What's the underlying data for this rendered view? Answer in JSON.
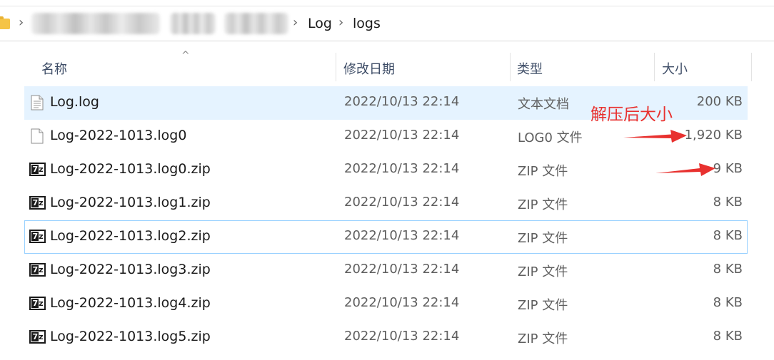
{
  "address_bar": {
    "separator": "›",
    "crumbs": [
      "Log",
      "logs"
    ]
  },
  "columns": {
    "name": "名称",
    "date": "修改日期",
    "type": "类型",
    "size": "大小",
    "sort_glyph": "^"
  },
  "files": [
    {
      "name": "Log.log",
      "date": "2022/10/13 22:14",
      "type": "文本文档",
      "size": "200 KB",
      "icon": "text-document-icon"
    },
    {
      "name": "Log-2022-1013.log0",
      "date": "2022/10/13 22:14",
      "type": "LOG0 文件",
      "size": "1,920 KB",
      "icon": "blank-file-icon"
    },
    {
      "name": "Log-2022-1013.log0.zip",
      "date": "2022/10/13 22:14",
      "type": "ZIP 文件",
      "size": "9 KB",
      "icon": "7zip-archive-icon"
    },
    {
      "name": "Log-2022-1013.log1.zip",
      "date": "2022/10/13 22:14",
      "type": "ZIP 文件",
      "size": "8 KB",
      "icon": "7zip-archive-icon"
    },
    {
      "name": "Log-2022-1013.log2.zip",
      "date": "2022/10/13 22:14",
      "type": "ZIP 文件",
      "size": "8 KB",
      "icon": "7zip-archive-icon"
    },
    {
      "name": "Log-2022-1013.log3.zip",
      "date": "2022/10/13 22:14",
      "type": "ZIP 文件",
      "size": "8 KB",
      "icon": "7zip-archive-icon"
    },
    {
      "name": "Log-2022-1013.log4.zip",
      "date": "2022/10/13 22:14",
      "type": "ZIP 文件",
      "size": "8 KB",
      "icon": "7zip-archive-icon"
    },
    {
      "name": "Log-2022-1013.log5.zip",
      "date": "2022/10/13 22:14",
      "type": "ZIP 文件",
      "size": "8 KB",
      "icon": "7zip-archive-icon"
    }
  ],
  "zip_icon_glyph_left": "7",
  "zip_icon_glyph_right": "z",
  "annotation": {
    "text": "解压后大小",
    "color": "#e8312f"
  },
  "colors": {
    "selected_row_bg": "#e5f3ff",
    "focused_row_border": "#99d1ff",
    "header_text": "#3d4c66",
    "folder": "#f5c446"
  }
}
